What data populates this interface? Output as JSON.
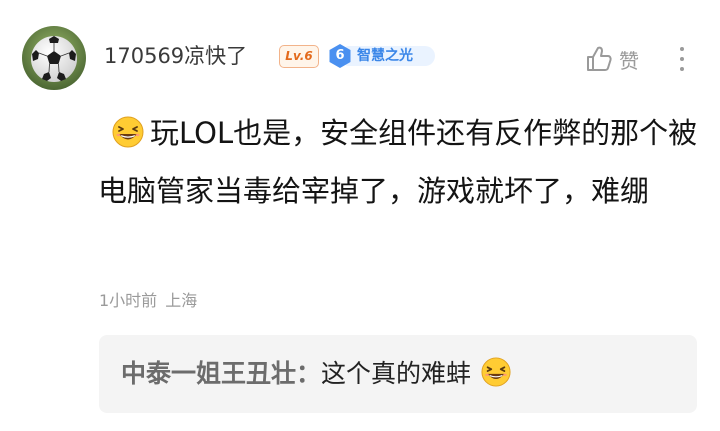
{
  "post": {
    "username": "170569凉快了",
    "level_badge": "Lv.6",
    "honor": {
      "level": "6",
      "title": "智慧之光"
    },
    "like_label": "赞",
    "emoji": "grinning-squint-emoji",
    "comment_text": "玩LOL也是，安全组件还有反作弊的那个被电脑管家当毒给宰掉了，游戏就坏了，难绷",
    "time": "1小时前",
    "location": "上海"
  },
  "reply": {
    "author": "中泰一姐王丑壮",
    "separator": "：",
    "content": "这个真的难蚌",
    "emoji": "grinning-squint-emoji"
  },
  "colors": {
    "level_badge_text": "#e36a1c",
    "honor_accent": "#3a86e8",
    "reply_background": "#f4f4f4"
  }
}
